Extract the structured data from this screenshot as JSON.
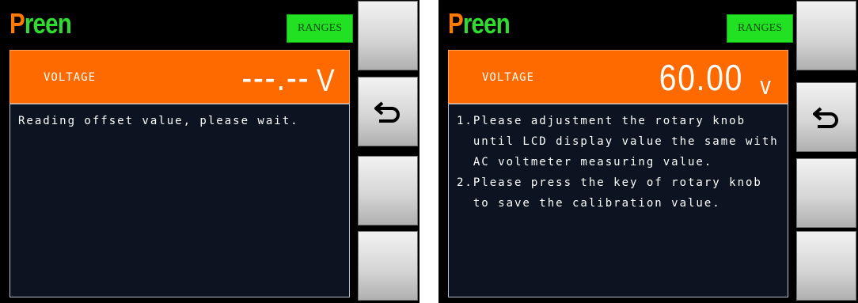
{
  "left_screen": {
    "logo": {
      "first_letter": "P",
      "rest": "reen"
    },
    "ranges_label": "RANGES",
    "voltage": {
      "label": "VOLTAGE",
      "value": "---.--",
      "unit": "V"
    },
    "message": "Reading offset value, please wait.",
    "side_buttons": [
      "",
      "back-icon",
      "",
      ""
    ]
  },
  "right_screen": {
    "logo": {
      "first_letter": "P",
      "rest": "reen"
    },
    "ranges_label": "RANGES",
    "voltage": {
      "label": "VOLTAGE",
      "value": "60.00",
      "unit": "v"
    },
    "instructions": [
      {
        "num": "1.",
        "text": "Please adjustment the rotary knob until LCD display value the same with AC voltmeter measuring value."
      },
      {
        "num": "2.",
        "text": "Please press the key of rotary knob to save the calibration value."
      }
    ],
    "side_buttons": [
      "",
      "back-icon",
      "",
      ""
    ]
  },
  "colors": {
    "logo_p": "#ff7a00",
    "logo_rest": "#2fdc2f",
    "ranges_bg": "#22e022",
    "voltage_bar": "#ff6a00",
    "content_bg": "#0b1420"
  }
}
